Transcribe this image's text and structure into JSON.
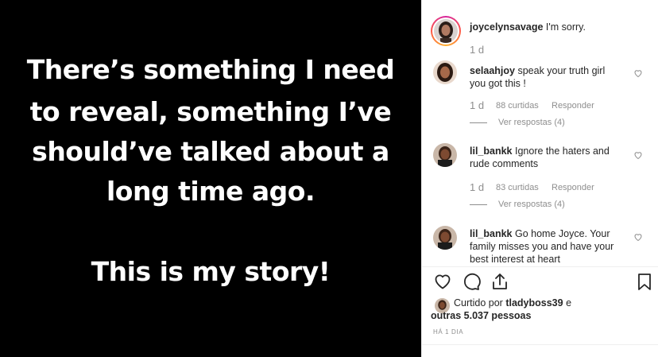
{
  "post": {
    "lines": [
      "There’s something I need",
      "to reveal, something I’ve",
      "should’ve talked about a",
      "long time ago.",
      "This is my story!"
    ]
  },
  "caption": {
    "username": "joycelynsavage",
    "text": "I'm sorry.",
    "time": "1 d"
  },
  "comments": [
    {
      "username": "selaahjoy",
      "text_line1": "speak your truth girl",
      "text_line2": "you got this !",
      "time": "1 d",
      "likes": "88 curtidas",
      "reply_label": "Responder",
      "view_replies": "Ver respostas (4)"
    },
    {
      "username": "lil_bankk",
      "text_line1": "Ignore the haters and",
      "text_line2": "rude comments",
      "time": "1 d",
      "likes": "83 curtidas",
      "reply_label": "Responder",
      "view_replies": "Ver respostas (4)"
    },
    {
      "username": "lil_bankk",
      "text_line1": "Go home Joyce. Your",
      "text_line2": "family misses you and have your",
      "text_line3": "best interest at heart"
    }
  ],
  "likes": {
    "prefix": "Curtido por",
    "user": "tladyboss39",
    "suffix": "e",
    "line2": "outras 5.037 pessoas"
  },
  "time_ago": "HÁ 1 DIA",
  "icons": [
    "heart-icon",
    "comment-icon",
    "share-icon",
    "bookmark-icon"
  ]
}
